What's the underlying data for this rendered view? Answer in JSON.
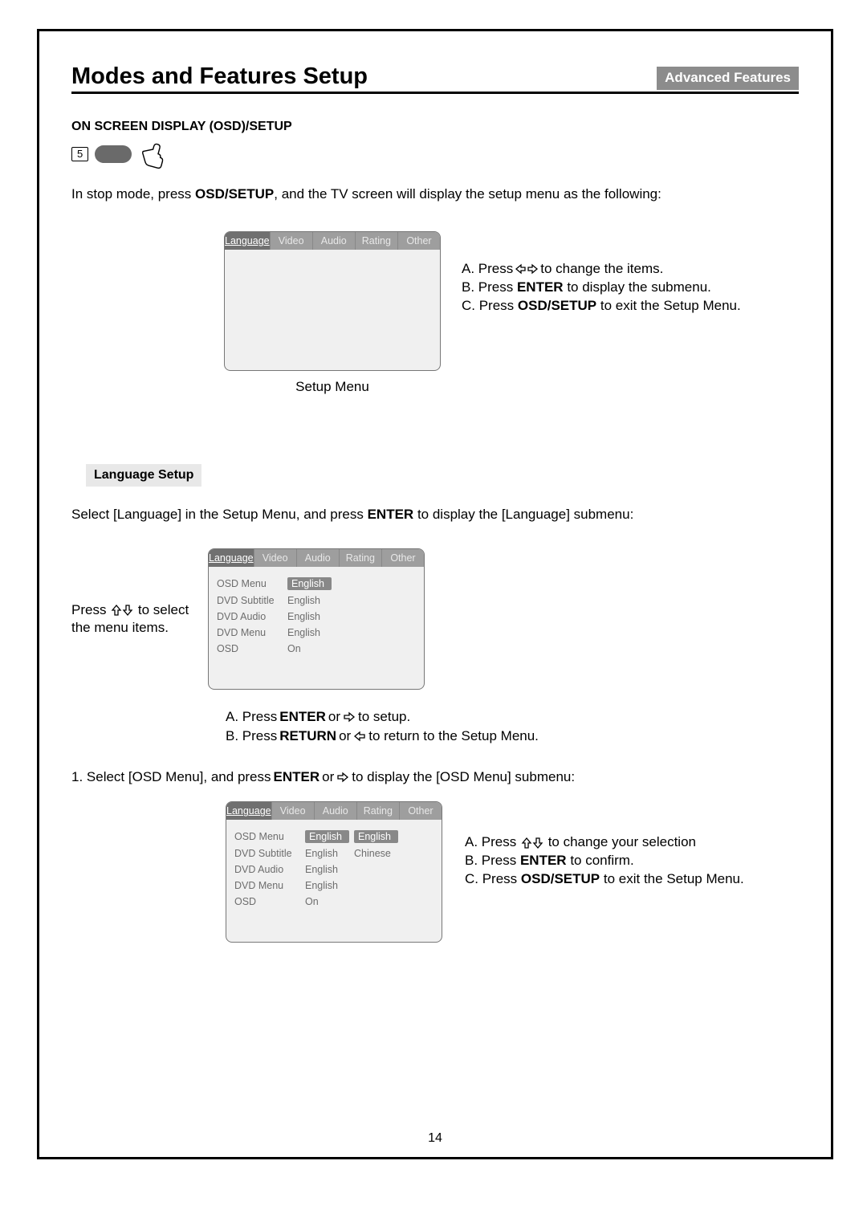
{
  "header": {
    "title": "Modes and Features Setup",
    "badge": "Advanced Features"
  },
  "osd_heading": "ON SCREEN DISPLAY (OSD)/SETUP",
  "step_number": "5",
  "intro_text_1": "In stop mode, press ",
  "intro_text_bold": "OSD/SETUP",
  "intro_text_2": ", and the TV screen will display the setup menu as the following:",
  "setup_tabs": [
    "Language",
    "Video",
    "Audio",
    "Rating",
    "Other"
  ],
  "setup_caption": "Setup Menu",
  "instr1": {
    "a_pre": "A. Press ",
    "a_post": " to change the items.",
    "b_pre": "B. Press ",
    "b_bold": "ENTER",
    "b_post": " to display the submenu.",
    "c_pre": "C. Press ",
    "c_bold": "OSD/SETUP",
    "c_post": " to exit the Setup Menu."
  },
  "lang_heading": "Language Setup",
  "lang_select_1": "Select [Language] in the Setup Menu, and press ",
  "lang_select_bold": "ENTER",
  "lang_select_2": " to display the [Language] submenu:",
  "left_note_pre": "Press ",
  "left_note_post": " to select the menu items.",
  "lang_menu_rows": [
    {
      "k": "OSD Menu",
      "v": "English",
      "hl": true
    },
    {
      "k": "DVD Subtitle",
      "v": "English"
    },
    {
      "k": "DVD Audio",
      "v": "English"
    },
    {
      "k": "DVD Menu",
      "v": "English"
    },
    {
      "k": "OSD",
      "v": "On"
    }
  ],
  "below_instr": {
    "a_pre": "A. Press ",
    "a_bold": "ENTER",
    "a_mid": " or ",
    "a_post": " to setup.",
    "b_pre": "B. Press ",
    "b_bold": "RETURN",
    "b_mid": " or ",
    "b_post": " to return to the Setup Menu."
  },
  "step1_pre": "1. Select [OSD Menu], and press ",
  "step1_bold": "ENTER",
  "step1_mid": " or ",
  "step1_post": " to display the [OSD Menu] submenu:",
  "osd_menu_rows": [
    {
      "k": "OSD Menu",
      "v": "English",
      "v2": "English",
      "hl_v": true,
      "hl_v2": true
    },
    {
      "k": "DVD Subtitle",
      "v": "English",
      "v2": "Chinese"
    },
    {
      "k": "DVD Audio",
      "v": "English"
    },
    {
      "k": "DVD Menu",
      "v": "English"
    },
    {
      "k": "OSD",
      "v": "On"
    }
  ],
  "instr3": {
    "a_pre": "A. Press ",
    "a_post": " to change your selection",
    "b_pre": "B. Press ",
    "b_bold": "ENTER",
    "b_post": " to confirm.",
    "c_pre": "C. Press ",
    "c_bold": "OSD/SETUP",
    "c_post": " to exit the Setup Menu."
  },
  "page_number": "14"
}
